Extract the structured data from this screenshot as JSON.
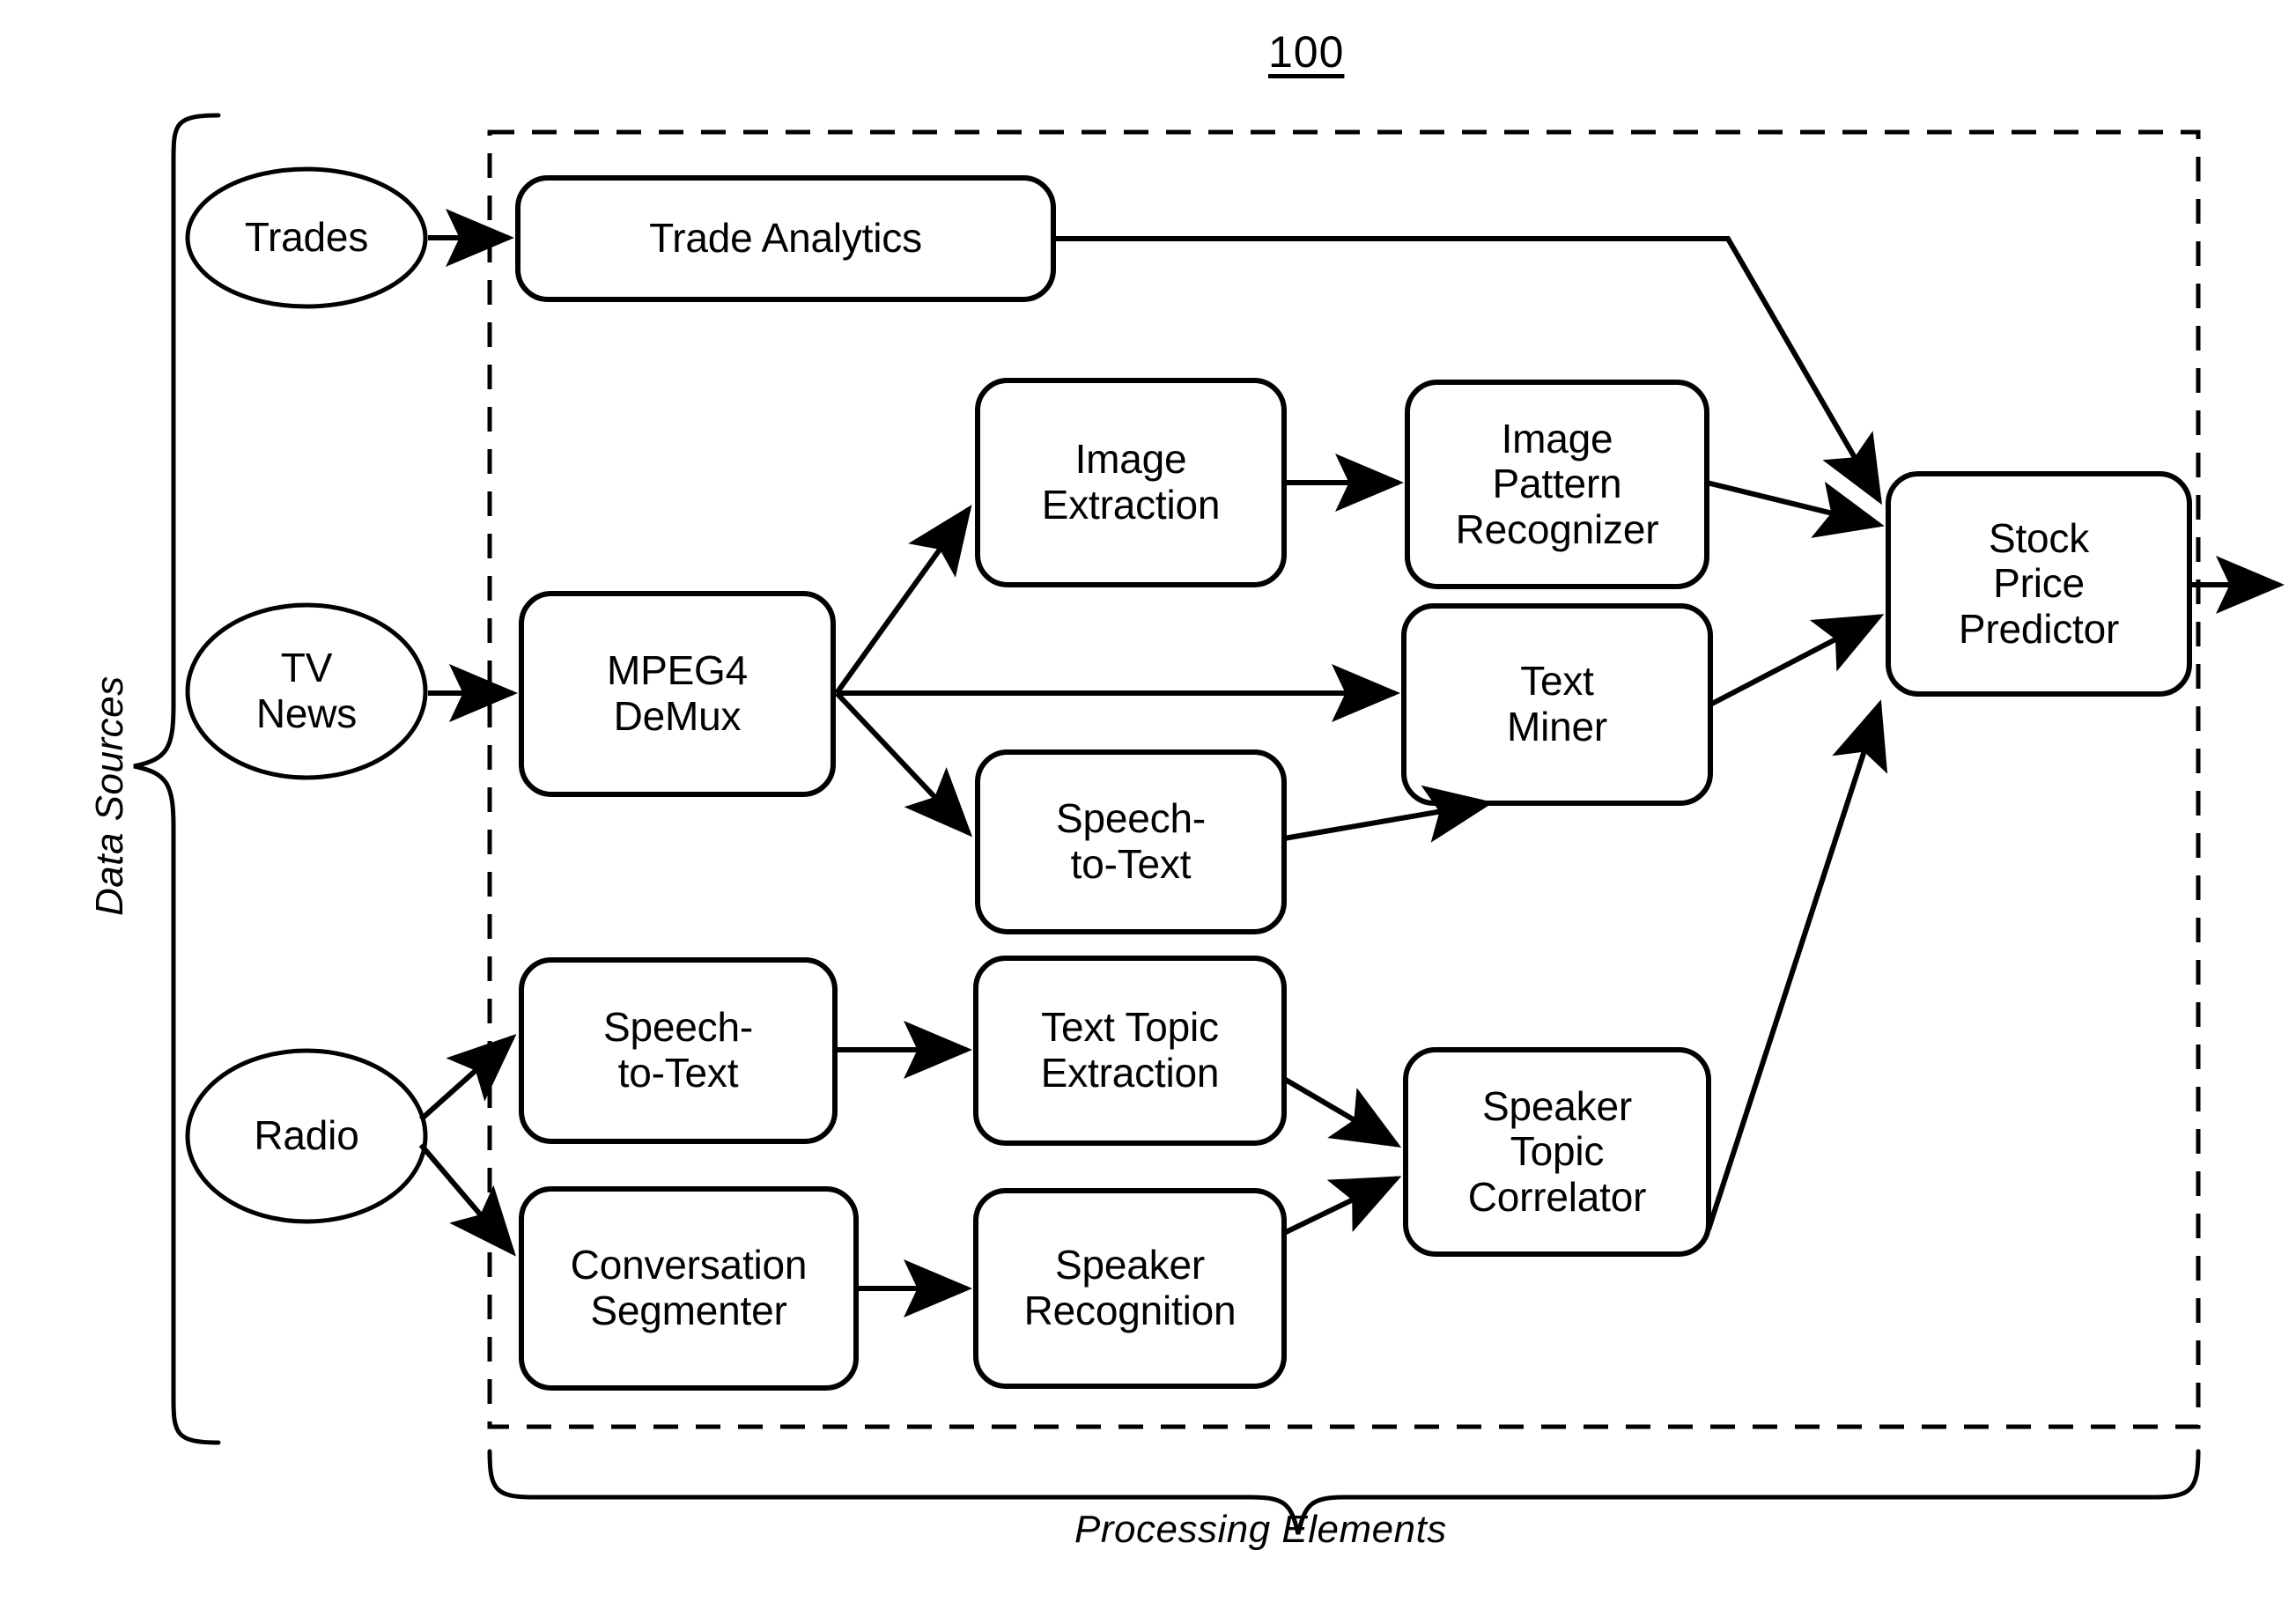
{
  "figure": {
    "number": "100"
  },
  "groups": {
    "data_sources_label": "Data Sources",
    "processing_elements_label": "Processing Elements"
  },
  "sources": [
    {
      "id": "trades",
      "label": "Trades"
    },
    {
      "id": "tv-news",
      "label": "TV\nNews"
    },
    {
      "id": "radio",
      "label": "Radio"
    }
  ],
  "processing_elements": [
    {
      "id": "trade-analytics",
      "label": "Trade Analytics"
    },
    {
      "id": "mpeg4-demux",
      "label": "MPEG4\nDeMux"
    },
    {
      "id": "image-extraction",
      "label": "Image\nExtraction"
    },
    {
      "id": "image-pattern-recognizer",
      "label": "Image\nPattern\nRecognizer"
    },
    {
      "id": "text-miner",
      "label": "Text\nMiner"
    },
    {
      "id": "speech-to-text-tv",
      "label": "Speech-\nto-Text"
    },
    {
      "id": "speech-to-text-radio",
      "label": "Speech-\nto-Text"
    },
    {
      "id": "text-topic-extraction",
      "label": "Text Topic\nExtraction"
    },
    {
      "id": "conversation-segmenter",
      "label": "Conversation\nSegmenter"
    },
    {
      "id": "speaker-recognition",
      "label": "Speaker\nRecognition"
    },
    {
      "id": "speaker-topic-correlator",
      "label": "Speaker\nTopic\nCorrelator"
    },
    {
      "id": "stock-price-predictor",
      "label": "Stock\nPrice\nPredictor"
    }
  ],
  "colors": {
    "stroke": "#000000",
    "background": "#ffffff"
  }
}
